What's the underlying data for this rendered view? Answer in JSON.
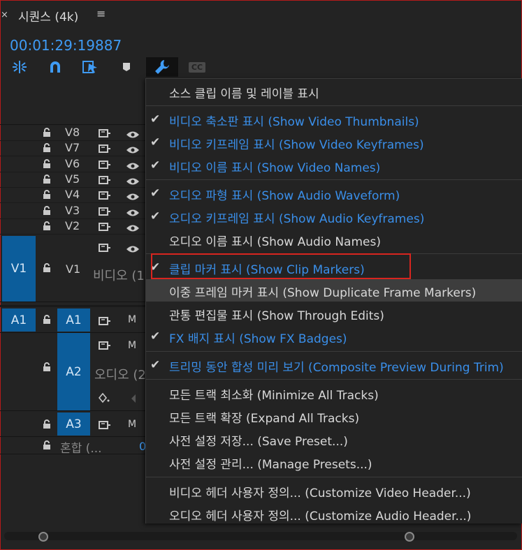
{
  "header": {
    "close_glyph": "×",
    "sequence_title": "시퀀스 (4k)",
    "menu_glyph": "≡",
    "timecode": "00:01:29:19887"
  },
  "toolbar": {
    "icons": [
      "snap-insert-icon",
      "magnet-icon",
      "linked-selection-icon",
      "marker-icon",
      "wrench-icon",
      "captions-icon"
    ],
    "captions_label": "CC"
  },
  "tracks": {
    "video": [
      {
        "name": "V8"
      },
      {
        "name": "V7"
      },
      {
        "name": "V6"
      },
      {
        "name": "V5"
      },
      {
        "name": "V4"
      },
      {
        "name": "V3"
      },
      {
        "name": "V2"
      }
    ],
    "v1": {
      "source": "V1",
      "name": "V1",
      "label": "비디오 (1"
    },
    "a1": {
      "source": "A1",
      "name": "A1",
      "mute": "M"
    },
    "a2": {
      "name": "A2",
      "label": "오디오 (2",
      "mute": "M"
    },
    "a3": {
      "name": "A3",
      "mute": "M"
    },
    "mix": {
      "label": "혼합 (...",
      "value": "0"
    }
  },
  "menu": {
    "items": [
      {
        "text": "소스 클립 이름 및 레이블 표시",
        "checked": false,
        "blue": false
      },
      {
        "text": "비디오 축소판 표시 (Show Video Thumbnails)",
        "checked": true,
        "blue": true
      },
      {
        "text": "비디오 키프레임 표시 (Show Video Keyframes)",
        "checked": true,
        "blue": true
      },
      {
        "text": "비디오 이름 표시 (Show Video Names)",
        "checked": true,
        "blue": true
      },
      {
        "text": "오디오 파형 표시 (Show Audio Waveform)",
        "checked": true,
        "blue": true
      },
      {
        "text": "오디오 키프레임 표시 (Show Audio Keyframes)",
        "checked": true,
        "blue": true
      },
      {
        "text": "오디오 이름 표시 (Show Audio Names)",
        "checked": false,
        "blue": false
      },
      {
        "text": "클립 마커 표시 (Show Clip Markers)",
        "checked": true,
        "blue": true
      },
      {
        "text": "이중 프레임 마커 표시 (Show Duplicate Frame Markers)",
        "checked": false,
        "blue": false
      },
      {
        "text": "관통 편집물 표시 (Show Through Edits)",
        "checked": false,
        "blue": false
      },
      {
        "text": "FX 배지 표시 (Show FX Badges)",
        "checked": true,
        "blue": true
      },
      {
        "text": "트리밍 동안 합성 미리 보기 (Composite Preview During Trim)",
        "checked": true,
        "blue": true
      },
      {
        "text": "모든 트랙 최소화 (Minimize All Tracks)",
        "checked": false,
        "blue": false
      },
      {
        "text": "모든 트랙 확장 (Expand All Tracks)",
        "checked": false,
        "blue": false
      },
      {
        "text": "사전 설정 저장... (Save Preset...)",
        "checked": false,
        "blue": false
      },
      {
        "text": "사전 설정 관리... (Manage Presets...)",
        "checked": false,
        "blue": false
      },
      {
        "text": "비디오 헤더 사용자 정의... (Customize Video Header...)",
        "checked": false,
        "blue": false
      },
      {
        "text": "오디오 헤더 사용자 정의... (Customize Audio Header...)",
        "checked": false,
        "blue": false
      }
    ],
    "check_glyph": "✔",
    "hovered_index": 8,
    "highlighted_index": 7
  },
  "colors": {
    "accent_blue": "#3a8fea",
    "track_target": "#0c5d9b",
    "highlight_box": "#d8251f"
  }
}
